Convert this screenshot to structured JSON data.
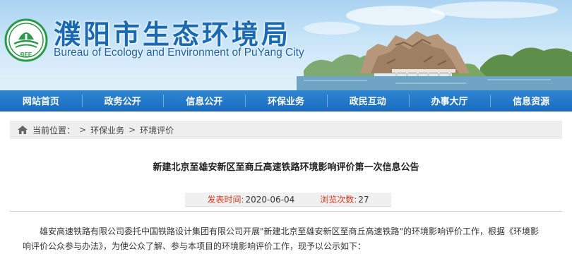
{
  "header": {
    "title_cn": "濮阳市生态环境局",
    "title_en": "Bureau of Ecology and Environment of PuYang City",
    "logo_text": "BEE",
    "logo_icon": "environmental-protection-emblem"
  },
  "nav": {
    "items": [
      {
        "label": "网站首页"
      },
      {
        "label": "政务公开"
      },
      {
        "label": "信息公开"
      },
      {
        "label": "环保业务"
      },
      {
        "label": "政民互动"
      },
      {
        "label": "办事大厅"
      },
      {
        "label": "信息资源"
      }
    ]
  },
  "breadcrumb": {
    "icon": "home-icon",
    "prefix": "当前位置：",
    "sep1": ">",
    "item1": "环保业务",
    "sep2": ">",
    "item2": "环境评价"
  },
  "article": {
    "title": "新建北京至雄安新区至商丘高速铁路环境影响评价第一次信息公告",
    "publish_label": "发表时间:",
    "publish_date": "2020-06-04",
    "views_label": "浏览次数:",
    "views_count": "27",
    "body": "雄安高速铁路有限公司委托中国铁路设计集团有限公司开展\"新建北京至雄安新区至商丘高速铁路\"的环境影响评价工作，根据《环境影响评价公众参与办法》，为使公众了解、参与本项目的环境影响评价工作，现予以公示如下："
  },
  "colors": {
    "nav_bg": "#1f74c6",
    "title_blue": "#1a6ab3",
    "meta_red": "#d23a1e",
    "breadcrumb_bg": "#eeeeee"
  }
}
